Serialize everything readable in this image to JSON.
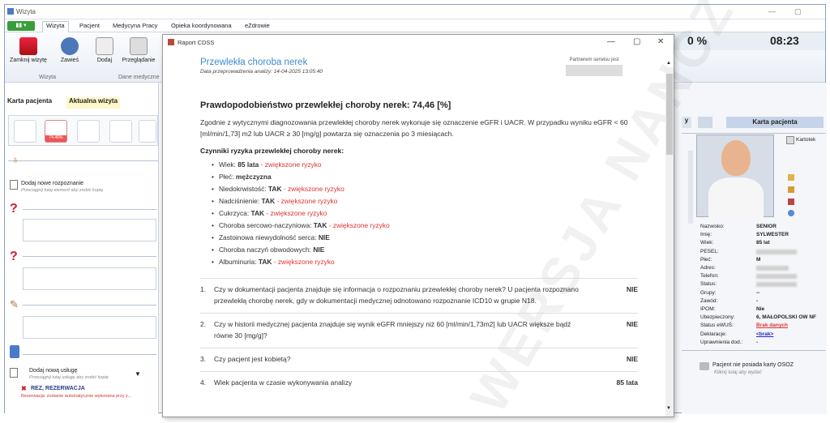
{
  "window": {
    "title": "Wizyta",
    "controls": [
      "—",
      "▢"
    ]
  },
  "menu": {
    "button": "▮▮ ▾",
    "items": [
      "Wizyta",
      "Pacjent",
      "Medycyna Pracy",
      "Opieka koordynowana",
      "eZdrowie"
    ]
  },
  "ribbon": {
    "buttons": [
      "Zamknij wizytę",
      "Zawieś",
      "Dodaj",
      "Przeglądanie"
    ],
    "groups": [
      "Wizyta",
      "Dane medyczne"
    ],
    "percent": "0 %",
    "time": "08:23"
  },
  "left": {
    "tabs": [
      "Karta pacjenta",
      "Aktualna wizyta"
    ],
    "kidney_badge": "74.46%",
    "add_diagnosis": {
      "label": "Dodaj nowe rozpoznanie",
      "hint": "Przeciągnij tutaj element aby zrobić kopię"
    },
    "add_service": {
      "label": "Dodaj nową usługę",
      "hint": "Przeciągnij tutaj usługę aby zrobić kopię"
    },
    "reservation": {
      "label": "REZ, REZERWACJA",
      "hint": "Rezerwacja: zostanie automatycznie wykonana przy z..."
    }
  },
  "right": {
    "header": "Karta pacjenta",
    "kartoteka": "Kartotek",
    "fields": [
      {
        "label": "Nazwisko:",
        "value": "SENIOR"
      },
      {
        "label": "Imię:",
        "value": "SYLWESTER"
      },
      {
        "label": "Wiek:",
        "value": "85 lat"
      },
      {
        "label": "PESEL:",
        "value": ""
      },
      {
        "label": "Płeć:",
        "value": "M"
      },
      {
        "label": "Adres:",
        "value": ""
      },
      {
        "label": "Telefon:",
        "value": ""
      },
      {
        "label": "Status:",
        "value": ""
      },
      {
        "label": "Grupy:",
        "value": "--"
      },
      {
        "label": "Zawód:",
        "value": "-"
      },
      {
        "label": "IPOM:",
        "value": "Nie"
      },
      {
        "label": "Ubezpieczony:",
        "value": "6, MAŁOPOLSKI OW NF"
      },
      {
        "label": "Status eWUŚ:",
        "value": "Brak danych"
      },
      {
        "label": "Deklaracje:",
        "value": "<brak>"
      },
      {
        "label": "Uprawnienia dod.:",
        "value": "-"
      }
    ],
    "osoz": {
      "label": "Pacjent nie posiada karty OSOZ",
      "hint": "Kliknij tutaj aby wydać"
    }
  },
  "dialog": {
    "title": "Raport CDSS",
    "heading": "Przewlekła choroba nerek",
    "date": "Data przeprowadzenia analizy: 14-04-2025 13:05:40",
    "partner": "Partnerem serwisu jest",
    "probability": "Prawdopodobieństwo przewlekłej choroby nerek: 74,46 [%]",
    "description": "Zgodnie z wytycznymi diagnozowania przewlekłej choroby nerek wykonuje się oznaczenie eGFR i UACR. W przypadku wyniku eGFR < 60 [ml/min/1,73] m2 lub UACR ≥ 30 [mg/g] powtarza się oznaczenia po 3 miesiącach.",
    "factors_title": "Czynniki ryzyka przewlekłej choroby nerek:",
    "factors": [
      {
        "label": "Wiek:",
        "value": "85 lata",
        "risk": "- zwiększone ryzyko"
      },
      {
        "label": "Płeć:",
        "value": "mężczyzna",
        "risk": ""
      },
      {
        "label": "Niedokrwistość:",
        "value": "TAK",
        "risk": "- zwiększone ryzyko"
      },
      {
        "label": "Nadciśnienie:",
        "value": "TAK",
        "risk": "- zwiększone ryzyko"
      },
      {
        "label": "Cukrzyca:",
        "value": "TAK",
        "risk": "- zwiększone ryzyko"
      },
      {
        "label": "Choroba sercowo-naczyniowa:",
        "value": "TAK",
        "risk": "- zwiększone ryzyko"
      },
      {
        "label": "Zastoinowa niewydolność serca:",
        "value": "NIE",
        "risk": ""
      },
      {
        "label": "Choroba naczyń obwodowych:",
        "value": "NIE",
        "risk": ""
      },
      {
        "label": "Albuminuria:",
        "value": "TAK",
        "risk": "- zwiększone ryzyko"
      }
    ],
    "questions": [
      {
        "n": "1.",
        "text": "Czy w dokumentacji pacjenta znajduje się informacja o rozpoznaniu przewlekłej choroby nerek? U pacjenta rozpoznano przewlekłą chorobę nerek, gdy w dokumentacji medycznej odnotowano rozpoznanie ICD10 w grupie N18.",
        "answer": "NIE"
      },
      {
        "n": "2.",
        "text": "Czy w historii medycznej pacjenta znajduje się wynik eGFR mniejszy niż 60 [ml/min/1,73m2] lub UACR większe bądź równe 30 [mg/g]?",
        "answer": "NIE"
      },
      {
        "n": "3.",
        "text": "Czy pacjent jest kobietą?",
        "answer": "NIE"
      },
      {
        "n": "4.",
        "text": "Wiek pacjenta w czasie wykonywania analizy",
        "answer": "85 lata"
      }
    ],
    "watermark": "WERSJA NANCZ"
  }
}
